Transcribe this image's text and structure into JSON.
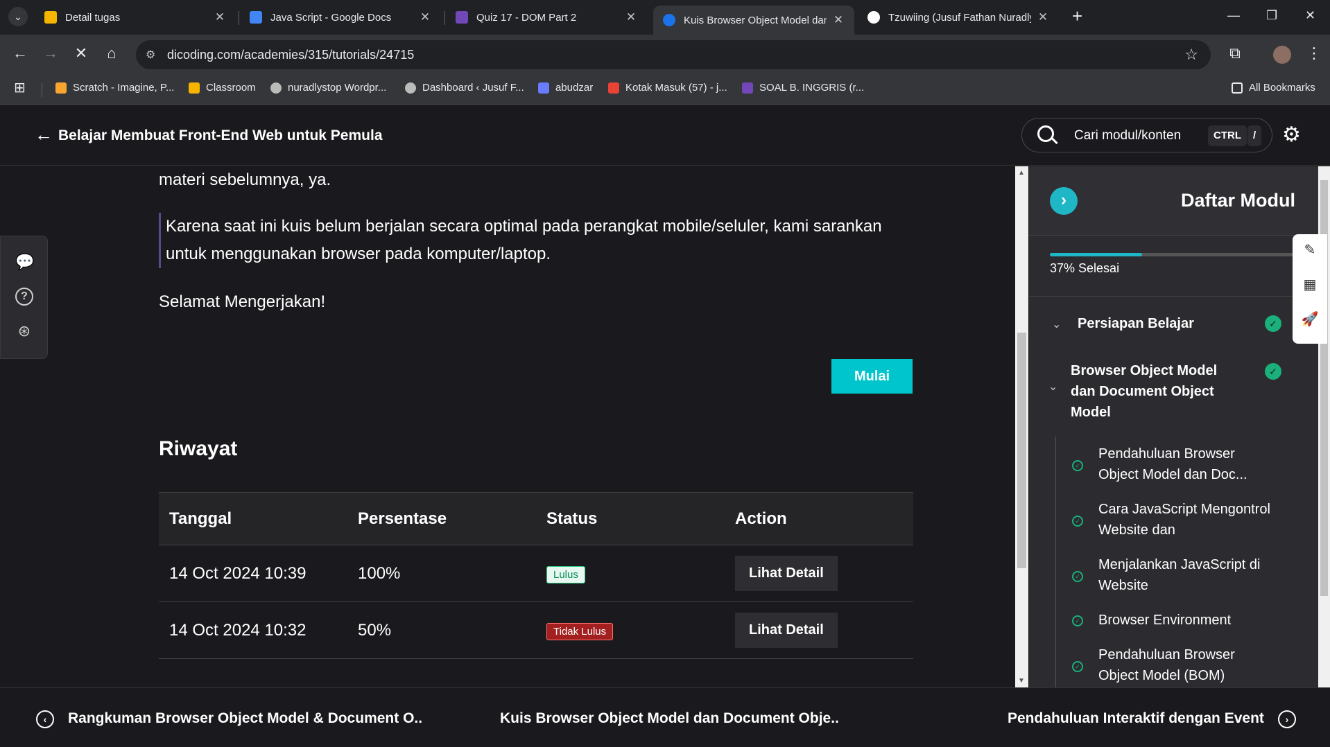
{
  "browser": {
    "tabs": [
      {
        "title": "Detail tugas",
        "color": "#f4b400",
        "active": false
      },
      {
        "title": "Java Script - Google Docs",
        "color": "#4285f4",
        "active": false
      },
      {
        "title": "Quiz 17 - DOM Part 2",
        "color": "#7248b9",
        "active": false
      },
      {
        "title": "Kuis Browser Object Model dan",
        "color": "#1a73e8",
        "active": true
      },
      {
        "title": "Tzuwiing (Jusuf Fathan Nuradly)",
        "color": "#ffffff",
        "active": false
      }
    ],
    "new_tab": "+",
    "url": "dicoding.com/academies/315/tutorials/24715",
    "bookmarks": [
      {
        "label": "Scratch - Imagine, P...",
        "color": "#f7a531"
      },
      {
        "label": "Classroom",
        "color": "#f4b400"
      },
      {
        "label": "nuradlystop Wordpr...",
        "color": "#bbbbbb"
      },
      {
        "label": "Dashboard ‹ Jusuf F...",
        "color": "#bbbbbb"
      },
      {
        "label": "abudzar",
        "color": "#6b7bff"
      },
      {
        "label": "Kotak Masuk (57) - j...",
        "color": "#ea4335"
      },
      {
        "label": "SOAL B. INGGRIS (r...",
        "color": "#7248b9"
      }
    ],
    "all_bookmarks": "All Bookmarks"
  },
  "header": {
    "course_title": "Belajar Membuat Front-End Web untuk Pemula",
    "search_placeholder": "Cari modul/konten",
    "kbd_ctrl": "CTRL",
    "kbd_slash": "/"
  },
  "content": {
    "intro_tail": "materi sebelumnya, ya.",
    "note": "Karena saat ini kuis belum berjalan secara optimal pada perangkat mobile/seluler, kami sarankan untuk menggunakan browser pada komputer/laptop.",
    "greeting": "Selamat Mengerjakan!",
    "start_button": "Mulai",
    "history_title": "Riwayat",
    "table": {
      "headers": [
        "Tanggal",
        "Persentase",
        "Status",
        "Action"
      ],
      "rows": [
        {
          "date": "14 Oct 2024 10:39",
          "percent": "100%",
          "status": "Lulus",
          "action": "Lihat Detail"
        },
        {
          "date": "14 Oct 2024 10:32",
          "percent": "50%",
          "status": "Tidak Lulus",
          "action": "Lihat Detail"
        }
      ]
    }
  },
  "sidebar": {
    "title": "Daftar Modul",
    "progress_value": 0.37,
    "progress_label": "37% Selesai",
    "groups": [
      {
        "name": "Persiapan Belajar",
        "done": true
      },
      {
        "name": "Browser Object Model dan Document Object Model",
        "done": true
      }
    ],
    "items": [
      "Pendahuluan Browser Object Model dan Doc...",
      "Cara JavaScript Mengontrol Website dan",
      "Menjalankan JavaScript di Website",
      "Browser Environment",
      "Pendahuluan Browser Object Model (BOM)"
    ]
  },
  "footer": {
    "prev": "Rangkuman Browser Object Model & Document O..",
    "current": "Kuis Browser Object Model dan Document Obje..",
    "next": "Pendahuluan Interaktif dengan Event"
  }
}
